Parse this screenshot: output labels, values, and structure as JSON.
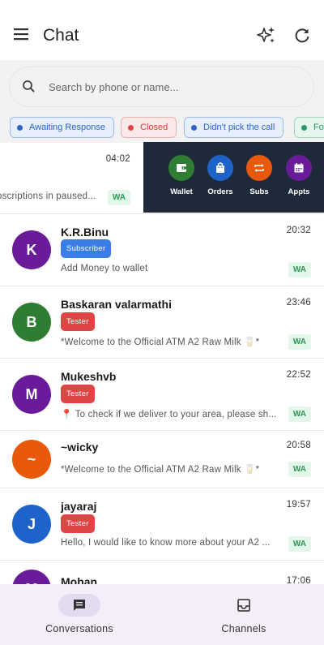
{
  "header": {
    "title": "Chat",
    "menu_icon": "menu-icon",
    "sparkle_icon": "sparkle-icon",
    "refresh_icon": "refresh-icon"
  },
  "search": {
    "placeholder": "Search by phone or name..."
  },
  "filters": [
    {
      "label": "Awaiting Response",
      "color": "#2f63c5"
    },
    {
      "label": "Closed",
      "color": "#d33a3a"
    },
    {
      "label": "Didn't pick the call",
      "color": "#2f63c5"
    },
    {
      "label": "Fol",
      "color": "#2b9a6a"
    }
  ],
  "swiped_row": {
    "time": "04:02",
    "message": "oscriptions in paused...",
    "channel": "WA"
  },
  "row_actions": [
    {
      "label": "Wallet",
      "icon": "wallet-icon",
      "color": "#2e7d32"
    },
    {
      "label": "Orders",
      "icon": "shopping-bag-icon",
      "color": "#1e63c9"
    },
    {
      "label": "Subs",
      "icon": "repeat-icon",
      "color": "#e8590c"
    },
    {
      "label": "Appts",
      "icon": "calendar-icon",
      "color": "#6a1b9a"
    }
  ],
  "conversations": [
    {
      "initial": "K",
      "name": "K.R.Binu",
      "time": "20:32",
      "tag": "Subscriber",
      "message": "Add Money to wallet",
      "channel": "WA",
      "avatar_color": "#6a1b9a"
    },
    {
      "initial": "B",
      "name": "Baskaran valarmathi",
      "time": "23:46",
      "tag": "Tester",
      "message": "*Welcome to the Official ATM A2 Raw Milk 🥛*",
      "channel": "WA",
      "avatar_color": "#2e7d32"
    },
    {
      "initial": "M",
      "name": "Mukeshvb",
      "time": "22:52",
      "tag": "Tester",
      "message": "📍 To check if we deliver to your area, please sh...",
      "channel": "WA",
      "avatar_color": "#6a1b9a"
    },
    {
      "initial": "~",
      "name": "~wicky",
      "time": "20:58",
      "tag": "",
      "message": "*Welcome to the Official ATM A2 Raw Milk 🥛*",
      "channel": "WA",
      "avatar_color": "#e8590c"
    },
    {
      "initial": "J",
      "name": "jayaraj",
      "time": "19:57",
      "tag": "Tester",
      "message": "Hello, I would like to know more about your A2 ...",
      "channel": "WA",
      "avatar_color": "#1e63c9"
    },
    {
      "initial": "M",
      "name": "Mohan",
      "time": "17:06",
      "tag": "",
      "message": "",
      "channel": "",
      "avatar_color": "#6a1b9a"
    }
  ],
  "bottom_nav": [
    {
      "label": "Conversations",
      "icon": "chat-bubble-icon",
      "active": true
    },
    {
      "label": "Channels",
      "icon": "inbox-icon",
      "active": false
    }
  ]
}
